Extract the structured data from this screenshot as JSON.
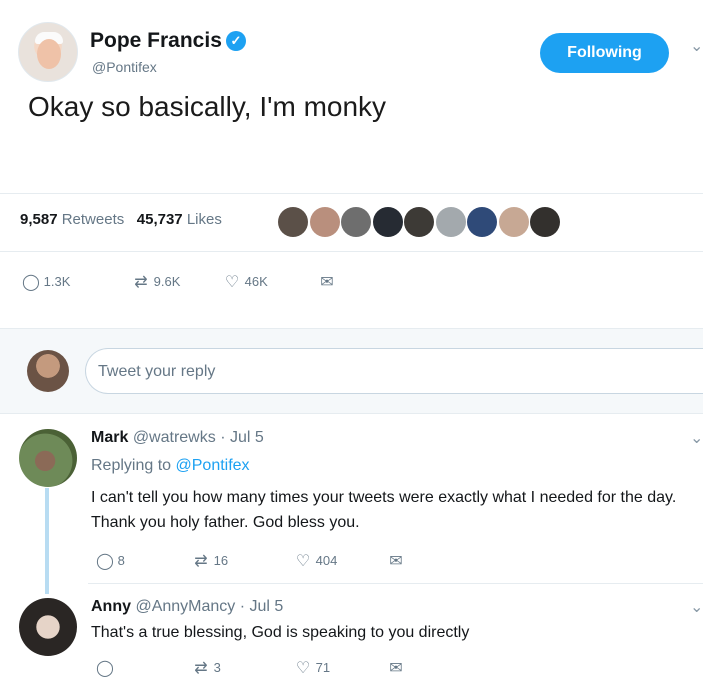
{
  "tweet": {
    "author_name": "Pope Francis",
    "handle": "@Pontifex",
    "verified_mark": "✓",
    "follow_button": "Following",
    "text": "Okay so basically, I'm monky",
    "retweets_count": "9,587",
    "retweets_label": "Retweets",
    "likes_count": "45,737",
    "likes_label": "Likes",
    "actions": {
      "replies": "1.3K",
      "retweets": "9.6K",
      "likes": "46K"
    }
  },
  "reply_box": {
    "placeholder": "Tweet your reply"
  },
  "replies": [
    {
      "name": "Mark",
      "handle": "@watrewks",
      "date": "· Jul 5",
      "replying_prefix": "Replying to",
      "replying_to": "@Pontifex",
      "text": "I can't tell you how many times your tweets were exactly what I needed for the day. Thank you holy father. God bless you.",
      "actions": {
        "replies": "8",
        "retweets": "16",
        "likes": "404"
      }
    },
    {
      "name": "Anny",
      "handle": "@AnnyMancy",
      "date": "· Jul 5",
      "text": "That's a true blessing, God is speaking to you directly",
      "actions": {
        "replies": "",
        "retweets": "3",
        "likes": "71"
      }
    }
  ],
  "icons": {
    "reply": "◯",
    "retweet": "⇄",
    "like": "♡",
    "message": "✉",
    "chevron": "⌄"
  },
  "colors": {
    "accent": "#1da1f2",
    "muted": "#657786",
    "thread": "#b8dcf2"
  }
}
